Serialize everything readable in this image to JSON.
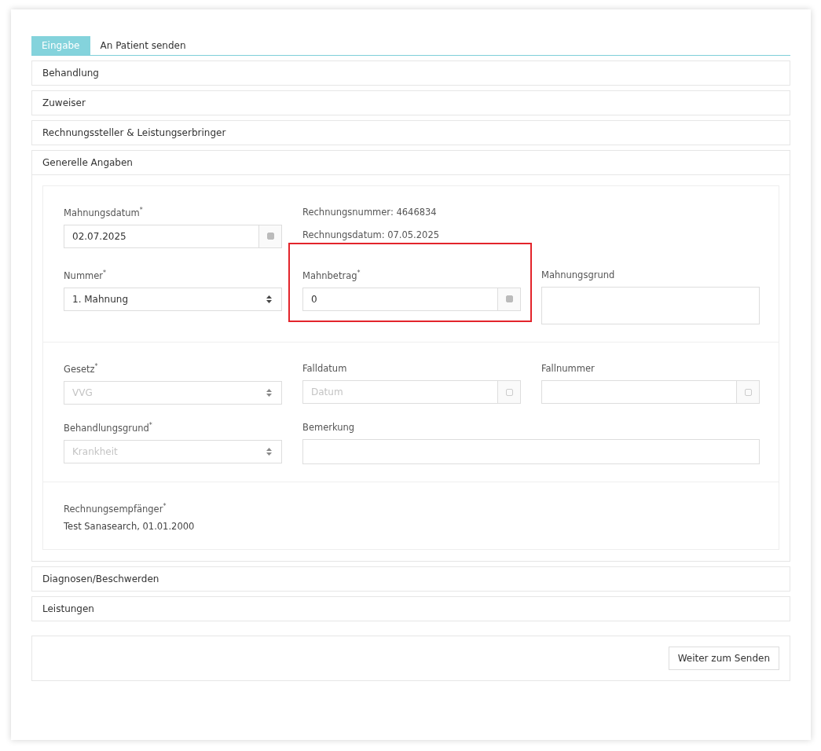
{
  "tabs": [
    {
      "label": "Eingabe",
      "selected": true
    },
    {
      "label": "An Patient senden",
      "selected": false
    }
  ],
  "sections_before": [
    {
      "title": "Behandlung",
      "expanded": false
    },
    {
      "title": "Zuweiser",
      "expanded": false
    },
    {
      "title": "Rechnungssteller & Leistungserbringer",
      "expanded": false
    }
  ],
  "general": {
    "title": "Generelle Angaben",
    "expanded": true,
    "groups": [
      {
        "rows": [
          {
            "cells": [
              {
                "kind": "date",
                "label": "Mahnungsdatum$^{*}$",
                "value": "02.07.2025",
                "disabled": false,
                "highlighted": false
              },
              {
                "kind": "info",
                "lines": [
                  "Rechnungsnummer: 4646834",
                  "Rechnungsdatum: 07.05.2025"
                ]
              }
            ]
          },
          {
            "cells": [
              {
                "kind": "select",
                "label": "Nummer$^{*}$",
                "value": "1. Mahnung",
                "disabled": false,
                "highlighted": false
              },
              {
                "kind": "amount",
                "label": "Mahnbetrag$^{*}$",
                "value": "0",
                "disabled": false,
                "highlighted": true
              },
              {
                "kind": "textarea",
                "label": "Mahnungsgrund",
                "disabled": false,
                "highlighted": false
              }
            ]
          }
        ]
      },
      {
        "rows": [
          {
            "cells": [
              {
                "kind": "select",
                "label": "Gesetz$^{*}$",
                "value": "VVG",
                "disabled": true,
                "highlighted": false
              },
              {
                "kind": "date",
                "label": "Falldatum",
                "placeholder": "Datum",
                "disabled": true,
                "highlighted": false
              },
              {
                "kind": "amount",
                "label": "Fallnummer",
                "disabled": true,
                "highlighted": false
              }
            ]
          },
          {
            "cells": [
              {
                "kind": "select",
                "label": "Behandlungsgrund$^{*}$",
                "value": "Krankheit",
                "disabled": true,
                "highlighted": false
              },
              {
                "kind": "text",
                "label": "Bemerkung",
                "disabled": false,
                "highlighted": false
              }
            ]
          }
        ]
      },
      {
        "rows": [
          {
            "cells": [
              {
                "kind": "static",
                "label": "Rechnungsempfänger$^{*}$",
                "value": "Test Sanasearch, 01.01.2000"
              }
            ]
          }
        ]
      }
    ]
  },
  "sections_after": [
    {
      "title": "Diagnosen/Beschwerden",
      "expanded": false
    },
    {
      "title": "Leistungen",
      "expanded": false
    }
  ],
  "footer": {
    "button": "Weiter zum Senden"
  }
}
